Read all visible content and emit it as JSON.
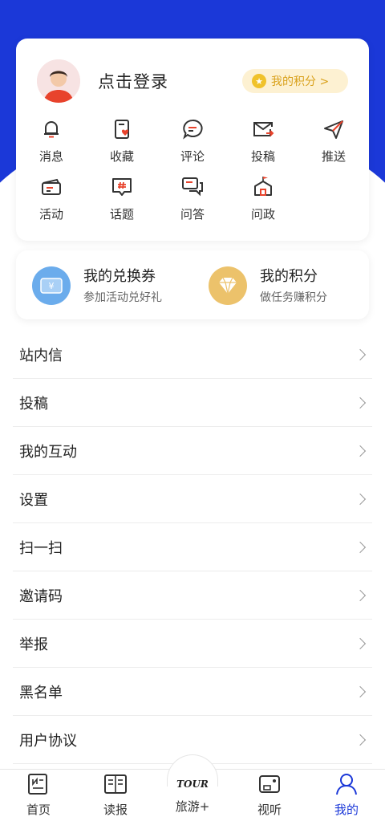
{
  "colors": {
    "brand_blue": "#1b38d8",
    "accent_red": "#e8432c",
    "gold": "#f0c22b"
  },
  "profile": {
    "login_text": "点击登录",
    "points_button": "我的积分 >",
    "grid": [
      {
        "label": "消息",
        "icon": "bell-icon"
      },
      {
        "label": "收藏",
        "icon": "bookmark-heart-icon"
      },
      {
        "label": "评论",
        "icon": "comment-icon"
      },
      {
        "label": "投稿",
        "icon": "mail-send-icon"
      },
      {
        "label": "推送",
        "icon": "send-icon"
      },
      {
        "label": "活动",
        "icon": "ticket-icon"
      },
      {
        "label": "话题",
        "icon": "hashtag-icon"
      },
      {
        "label": "问答",
        "icon": "qa-icon"
      },
      {
        "label": "问政",
        "icon": "building-flag-icon"
      }
    ]
  },
  "exchange": {
    "coupon_title": "我的兑换券",
    "coupon_sub": "参加活动兑好礼",
    "coupon_symbol": "¥",
    "points_title": "我的积分",
    "points_sub": "做任务赚积分"
  },
  "menu": [
    "站内信",
    "投稿",
    "我的互动",
    "设置",
    "扫一扫",
    "邀请码",
    "举报",
    "黑名单",
    "用户协议"
  ],
  "tabbar": {
    "tabs": [
      {
        "label": "首页",
        "icon": "newspaper-icon",
        "active": false
      },
      {
        "label": "读报",
        "icon": "reader-icon",
        "active": false
      },
      {
        "label": "旅游+",
        "icon": "tour-logo-icon",
        "active": false
      },
      {
        "label": "视听",
        "icon": "video-icon",
        "active": false
      },
      {
        "label": "我的",
        "icon": "user-icon",
        "active": true
      }
    ],
    "tour_logo_text": "TOUR"
  }
}
